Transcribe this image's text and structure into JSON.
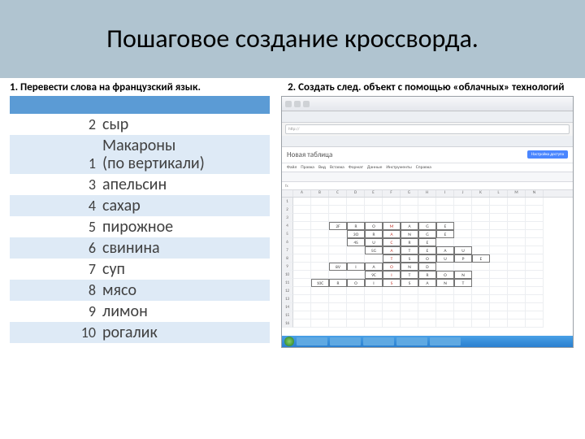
{
  "title": "Пошаговое создание кроссворда.",
  "subtitle_left": "1. Перевести слова на французский язык.",
  "subtitle_right": "2. Создать след. объект с помощью «облачных» технологий",
  "words": [
    {
      "n": "2",
      "w": "сыр"
    },
    {
      "n": "1",
      "w": "Макароны (по вертикали)"
    },
    {
      "n": "3",
      "w": "апельсин"
    },
    {
      "n": "4",
      "w": "сахар"
    },
    {
      "n": "5",
      "w": "пирожное"
    },
    {
      "n": "6",
      "w": "свинина"
    },
    {
      "n": "7",
      "w": "суп"
    },
    {
      "n": "8",
      "w": "мясо"
    },
    {
      "n": "9",
      "w": "лимон"
    },
    {
      "n": "10",
      "w": "рогалик"
    }
  ],
  "sheet": {
    "doc_title": "Новая таблица",
    "share_btn": "Настройка доступа",
    "menu": [
      "Файл",
      "Правка",
      "Вид",
      "Вставка",
      "Формат",
      "Данные",
      "Инструменты",
      "Справка"
    ],
    "fx_label": "fx",
    "cols": [
      "",
      "A",
      "B",
      "C",
      "D",
      "E",
      "F",
      "G",
      "H",
      "I",
      "J",
      "K",
      "L",
      "M",
      "N"
    ],
    "rows": [
      {
        "rh": "1",
        "cells": [
          "",
          "",
          "",
          "",
          "",
          "",
          "",
          "",
          "",
          "",
          "",
          "",
          "",
          ""
        ]
      },
      {
        "rh": "2",
        "cells": [
          "",
          "",
          "",
          "",
          "",
          "",
          "",
          "",
          "",
          "",
          "",
          "",
          "",
          ""
        ]
      },
      {
        "rh": "3",
        "cells": [
          "",
          "",
          "",
          "",
          "",
          "",
          "",
          "",
          "",
          "",
          "",
          "",
          "",
          ""
        ]
      },
      {
        "rh": "4",
        "cells": [
          "",
          "",
          "2F",
          "R",
          "O",
          "M",
          "A",
          "G",
          "E",
          "",
          "",
          "",
          "",
          ""
        ]
      },
      {
        "rh": "5",
        "cells": [
          "",
          "",
          "",
          "3O",
          "R",
          "A",
          "N",
          "G",
          "E",
          "",
          "",
          "",
          "",
          ""
        ]
      },
      {
        "rh": "6",
        "cells": [
          "",
          "",
          "",
          "4S",
          "U",
          "C",
          "R",
          "E",
          "",
          "",
          "",
          "",
          "",
          ""
        ]
      },
      {
        "rh": "7",
        "cells": [
          "",
          "",
          "",
          "",
          "5G",
          "A",
          "T",
          "E",
          "A",
          "U",
          "",
          "",
          "",
          ""
        ]
      },
      {
        "rh": "8",
        "cells": [
          "",
          "",
          "",
          "",
          "",
          "T",
          "S",
          "O",
          "U",
          "P",
          "E",
          "",
          "",
          ""
        ]
      },
      {
        "rh": "9",
        "cells": [
          "",
          "",
          "8V",
          "I",
          "A",
          "O",
          "N",
          "D",
          "",
          "",
          "",
          "",
          "",
          ""
        ]
      },
      {
        "rh": "10",
        "cells": [
          "",
          "",
          "",
          "",
          "9C",
          "I",
          "T",
          "R",
          "O",
          "N",
          "",
          "",
          "",
          ""
        ]
      },
      {
        "rh": "11",
        "cells": [
          "",
          "10C",
          "R",
          "O",
          "I",
          "S",
          "S",
          "A",
          "N",
          "T",
          "",
          "",
          "",
          ""
        ]
      },
      {
        "rh": "12",
        "cells": [
          "",
          "",
          "",
          "",
          "",
          "",
          "",
          "",
          "",
          "",
          "",
          "",
          "",
          ""
        ]
      },
      {
        "rh": "13",
        "cells": [
          "",
          "",
          "",
          "",
          "",
          "",
          "",
          "",
          "",
          "",
          "",
          "",
          "",
          ""
        ]
      },
      {
        "rh": "14",
        "cells": [
          "",
          "",
          "",
          "",
          "",
          "",
          "",
          "",
          "",
          "",
          "",
          "",
          "",
          ""
        ]
      },
      {
        "rh": "15",
        "cells": [
          "",
          "",
          "",
          "",
          "",
          "",
          "",
          "",
          "",
          "",
          "",
          "",
          "",
          ""
        ]
      },
      {
        "rh": "16",
        "cells": [
          "",
          "",
          "",
          "",
          "",
          "",
          "",
          "",
          "",
          "",
          "",
          "",
          "",
          ""
        ]
      }
    ],
    "vertical_red_col": 5
  }
}
